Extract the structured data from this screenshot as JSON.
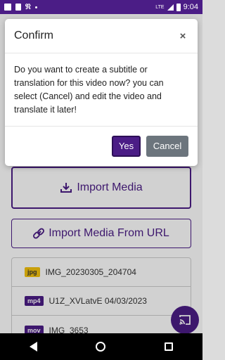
{
  "status_bar": {
    "time": "9:04",
    "network": "LTE"
  },
  "app": {
    "import_media_label": "Import Media",
    "import_url_label": "Import Media From URL",
    "media_items": [
      {
        "badge": "jpg",
        "name": "IMG_20230305_204704"
      },
      {
        "badge": "mp4",
        "name": "U1Z_XVLatvE 04/03/2023"
      },
      {
        "badge": "mov",
        "name": "IMG_3653"
      }
    ]
  },
  "dialog": {
    "title": "Confirm",
    "close_symbol": "×",
    "message": "Do you want to create a subtitle or translation for this video now? you can select (Cancel) and edit the video and translate it later!",
    "yes_label": "Yes",
    "cancel_label": "Cancel"
  },
  "colors": {
    "accent": "#4b1d86",
    "cancel": "#6c757d",
    "jpg_badge": "#f4c20d"
  },
  "icons": [
    "gmail-icon",
    "sd-card-icon",
    "nyt-icon",
    "notification-dot-icon",
    "signal-icon",
    "battery-icon",
    "download-icon",
    "link-icon",
    "cast-icon",
    "back-icon",
    "home-icon",
    "recents-icon"
  ]
}
